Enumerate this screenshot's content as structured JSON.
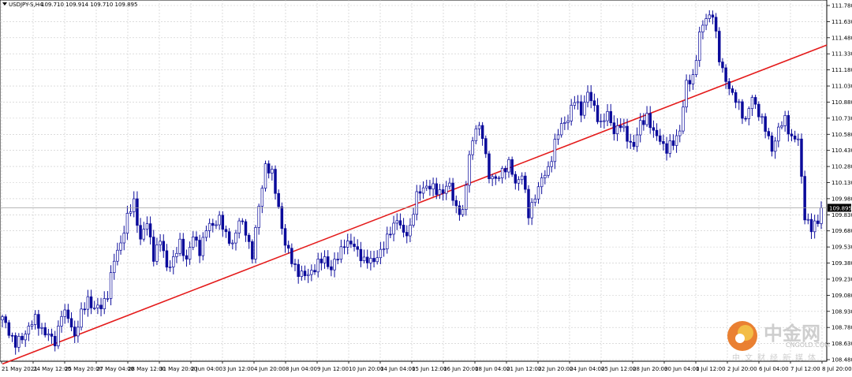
{
  "window": {
    "symbol_header": "USDJPY-S,H4",
    "ohlc_header": "109.710 109.914 109.710 109.895"
  },
  "watermark": {
    "brand_cn": "中金网",
    "brand_en": "CNGOLD.COM",
    "tagline_cn": "中文财经新媒体",
    "logo_colors": [
      "#e8731c",
      "#f2b632"
    ]
  },
  "colors": {
    "bull_candle": "#ffffff",
    "bear_candle": "#0b0b9b",
    "trendline": "#e41b1b",
    "grid": "#c8c8c8",
    "bid_line": "#a0a0a0",
    "price_tag_bg": "#000000"
  },
  "chart_data": {
    "type": "candlestick",
    "title": "USDJPY-S,H4",
    "price_axis": {
      "ticks": [
        "111.780",
        "111.630",
        "111.480",
        "111.330",
        "111.180",
        "111.030",
        "110.880",
        "110.730",
        "110.580",
        "110.430",
        "110.280",
        "110.130",
        "109.980",
        "109.830",
        "109.680",
        "109.530",
        "109.380",
        "109.230",
        "109.080",
        "108.930",
        "108.780",
        "108.630",
        "108.480"
      ],
      "ylim": [
        108.44,
        111.82
      ]
    },
    "current_price": "109.895",
    "time_axis": {
      "labels": [
        "21 May 2021",
        "24 May 12:00",
        "25 May 20:00",
        "27 May 04:00",
        "28 May 12:00",
        "31 May 20:00",
        "2 Jun 04:00",
        "3 Jun 12:00",
        "4 Jun 20:00",
        "8 Jun 04:00",
        "9 Jun 12:00",
        "10 Jun 20:00",
        "14 Jun 04:00",
        "15 Jun 12:00",
        "16 Jun 20:00",
        "18 Jun 04:00",
        "21 Jun 12:00",
        "22 Jun 20:00",
        "24 Jun 04:00",
        "25 Jun 12:00",
        "28 Jun 20:00",
        "30 Jun 04:00",
        "1 Jul 12:00",
        "2 Jul 20:00",
        "6 Jul 04:00",
        "7 Jul 12:00",
        "8 Jul 20:00"
      ]
    },
    "trendline": {
      "from": {
        "bar": 0,
        "price": 108.44
      },
      "to": {
        "bar": 178,
        "price": 110.55
      }
    },
    "grid": true,
    "anchors": [
      [
        0,
        108.86
      ],
      [
        2,
        108.75
      ],
      [
        4,
        108.62
      ],
      [
        6,
        108.68
      ],
      [
        8,
        108.79
      ],
      [
        10,
        108.85
      ],
      [
        12,
        108.77
      ],
      [
        14,
        108.7
      ],
      [
        16,
        108.64
      ],
      [
        18,
        108.92
      ],
      [
        20,
        108.87
      ],
      [
        22,
        108.71
      ],
      [
        24,
        108.9
      ],
      [
        26,
        109.05
      ],
      [
        28,
        108.95
      ],
      [
        30,
        108.97
      ],
      [
        32,
        109.1
      ],
      [
        34,
        109.4
      ],
      [
        36,
        109.58
      ],
      [
        38,
        109.8
      ],
      [
        40,
        109.95
      ],
      [
        42,
        109.6
      ],
      [
        44,
        109.75
      ],
      [
        46,
        109.45
      ],
      [
        48,
        109.59
      ],
      [
        50,
        109.35
      ],
      [
        52,
        109.41
      ],
      [
        54,
        109.56
      ],
      [
        56,
        109.42
      ],
      [
        58,
        109.62
      ],
      [
        60,
        109.5
      ],
      [
        62,
        109.7
      ],
      [
        64,
        109.73
      ],
      [
        66,
        109.81
      ],
      [
        68,
        109.62
      ],
      [
        70,
        109.57
      ],
      [
        72,
        109.77
      ],
      [
        74,
        109.68
      ],
      [
        76,
        109.45
      ],
      [
        78,
        109.9
      ],
      [
        80,
        110.3
      ],
      [
        82,
        110.2
      ],
      [
        84,
        109.9
      ],
      [
        86,
        109.55
      ],
      [
        88,
        109.4
      ],
      [
        90,
        109.3
      ],
      [
        92,
        109.25
      ],
      [
        94,
        109.31
      ],
      [
        96,
        109.37
      ],
      [
        98,
        109.42
      ],
      [
        100,
        109.33
      ],
      [
        102,
        109.43
      ],
      [
        104,
        109.58
      ],
      [
        106,
        109.55
      ],
      [
        108,
        109.5
      ],
      [
        110,
        109.4
      ],
      [
        112,
        109.39
      ],
      [
        114,
        109.45
      ],
      [
        116,
        109.52
      ],
      [
        118,
        109.7
      ],
      [
        120,
        109.78
      ],
      [
        122,
        109.65
      ],
      [
        124,
        109.71
      ],
      [
        126,
        110.0
      ],
      [
        128,
        110.1
      ],
      [
        130,
        110.08
      ],
      [
        132,
        110.06
      ],
      [
        134,
        110.05
      ],
      [
        136,
        110.1
      ],
      [
        138,
        109.9
      ],
      [
        140,
        109.83
      ],
      [
        142,
        110.4
      ],
      [
        144,
        110.65
      ],
      [
        146,
        110.57
      ],
      [
        148,
        110.2
      ],
      [
        150,
        110.14
      ],
      [
        152,
        110.25
      ],
      [
        154,
        110.3
      ],
      [
        156,
        110.12
      ],
      [
        158,
        110.22
      ],
      [
        160,
        109.82
      ],
      [
        162,
        110.02
      ],
      [
        164,
        110.15
      ],
      [
        166,
        110.26
      ],
      [
        168,
        110.5
      ],
      [
        170,
        110.66
      ],
      [
        172,
        110.74
      ],
      [
        174,
        110.89
      ],
      [
        176,
        110.8
      ],
      [
        178,
        110.96
      ],
      [
        180,
        110.82
      ],
      [
        182,
        110.68
      ],
      [
        184,
        110.76
      ],
      [
        186,
        110.62
      ],
      [
        188,
        110.66
      ],
      [
        190,
        110.55
      ],
      [
        192,
        110.47
      ],
      [
        194,
        110.67
      ],
      [
        196,
        110.76
      ],
      [
        198,
        110.58
      ],
      [
        200,
        110.54
      ],
      [
        202,
        110.43
      ],
      [
        204,
        110.5
      ],
      [
        206,
        110.63
      ],
      [
        208,
        111.04
      ],
      [
        210,
        111.12
      ],
      [
        212,
        111.5
      ],
      [
        214,
        111.67
      ],
      [
        216,
        111.71
      ],
      [
        218,
        111.27
      ],
      [
        220,
        111.1
      ],
      [
        222,
        110.93
      ],
      [
        224,
        110.86
      ],
      [
        226,
        110.7
      ],
      [
        228,
        110.92
      ],
      [
        230,
        110.79
      ],
      [
        232,
        110.62
      ],
      [
        234,
        110.45
      ],
      [
        236,
        110.62
      ],
      [
        238,
        110.72
      ],
      [
        240,
        110.55
      ],
      [
        242,
        110.52
      ],
      [
        244,
        109.83
      ],
      [
        246,
        109.69
      ],
      [
        248,
        109.77
      ],
      [
        249,
        109.895
      ]
    ]
  }
}
